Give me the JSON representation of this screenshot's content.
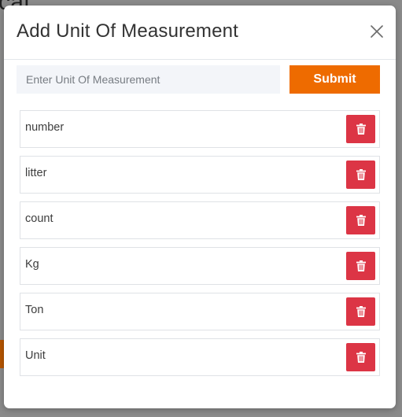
{
  "background": {
    "title_fragment": "cat"
  },
  "modal": {
    "title": "Add Unit Of Measurement",
    "close_icon": "close-icon",
    "input": {
      "value": "",
      "placeholder": "Enter Unit Of Measurement"
    },
    "submit_label": "Submit",
    "units": [
      {
        "name": "number"
      },
      {
        "name": "litter"
      },
      {
        "name": "count"
      },
      {
        "name": "Kg"
      },
      {
        "name": "Ton"
      },
      {
        "name": "Unit"
      }
    ],
    "delete_icon": "trash-icon"
  },
  "colors": {
    "accent": "#ee6b00",
    "danger": "#dc3545",
    "input_bg": "#f3f5f9",
    "overlay": "#8a8a8a"
  }
}
